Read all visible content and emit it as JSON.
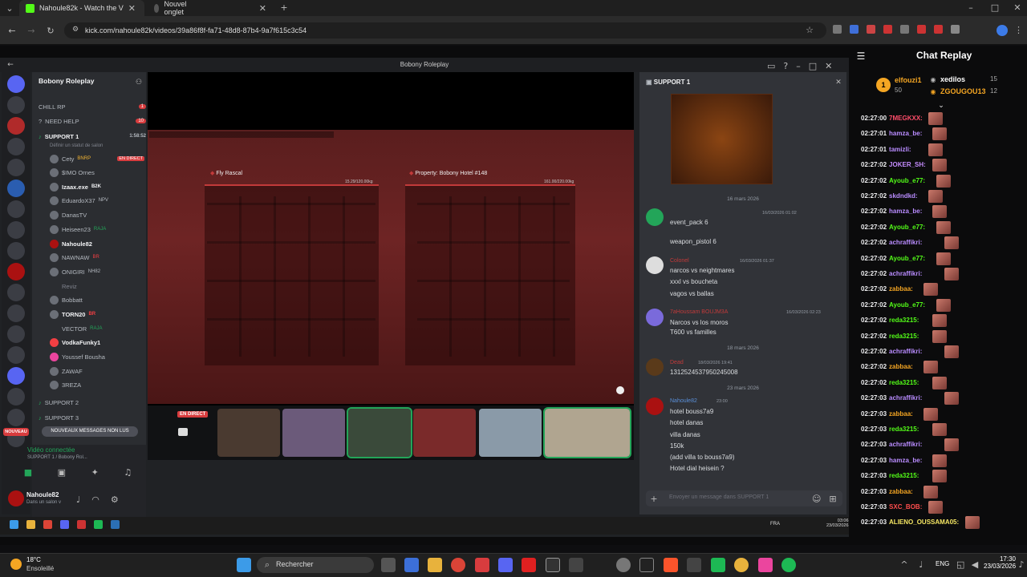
{
  "browser": {
    "tabs": [
      {
        "label": "Nahoule82k - Watch the V",
        "active": true
      },
      {
        "label": "Nouvel onglet",
        "active": false
      }
    ],
    "url": "kick.com/nahoule82k/videos/39a86f8f-fa71-48d8-87b4-9a7f615c3c54"
  },
  "discord": {
    "window_title": "Bobony Roleplay",
    "server_name": "Bobony Roleplay",
    "channels": [
      {
        "label": "CHILL RP",
        "badge": "1"
      },
      {
        "label": "NEED HELP",
        "badge": "10"
      },
      {
        "label": "SUPPORT 1",
        "badge": "1:58:52"
      }
    ],
    "status_hint": "Définir un statut de salon",
    "members": [
      {
        "name": "Cety",
        "tag": "BNRP",
        "live": "EN DIRECT"
      },
      {
        "name": "$IMO Ornes",
        "tag": ""
      },
      {
        "name": "Izaax.exe",
        "tag": "B2K"
      },
      {
        "name": "EduardoX37",
        "tag": "NPV"
      },
      {
        "name": "DanasTV",
        "tag": ""
      },
      {
        "name": "Heiseen23",
        "tag": "RAJA"
      },
      {
        "name": "Nahoule82",
        "tag": ""
      },
      {
        "name": "NAWNAW",
        "tag": "BR"
      },
      {
        "name": "ONIGIRI",
        "tag": "NH82"
      },
      {
        "name": "Reviz",
        "tag": ""
      },
      {
        "name": "Bobbatt",
        "tag": ""
      },
      {
        "name": "TORN20",
        "tag": "BR"
      },
      {
        "name": "VECTOR",
        "tag": "RAJA"
      },
      {
        "name": "VodkaFunky1",
        "tag": ""
      },
      {
        "name": "Youssef Bousha",
        "tag": ""
      },
      {
        "name": "ZAWAF",
        "tag": ""
      },
      {
        "name": "3REZA",
        "tag": ""
      }
    ],
    "other_channels": [
      "SUPPORT 2",
      "SUPPORT 3"
    ],
    "unread_button": "NOUVEAUX MESSAGES NON LUS",
    "voice_status": "Vidéo connectée",
    "voice_channel": "SUPPORT 1 / Bobony Rol...",
    "user_name": "Nahoule82",
    "user_status": "Dans un salon v",
    "new_badge": "NOUVEAU",
    "stream_live": "EN DIRECT",
    "game": {
      "left_panel": "Fly Rascal",
      "left_capacity": "15.29/120.00kg",
      "right_panel": "Property: Bobony Hotel #148",
      "right_capacity": "161.00/220.00kg"
    },
    "chat": {
      "channel": "SUPPORT 1",
      "messages": [
        {
          "type": "date",
          "text": "16 mars 2026"
        },
        {
          "type": "user",
          "name": "",
          "time": "16/03/2026 01:02",
          "lines": [
            "event_pack 6",
            "weapon_pistol 6"
          ]
        },
        {
          "type": "user",
          "name": "Colonel",
          "time": "16/03/2026 01:37",
          "lines": [
            "narcos vs neightmares",
            "xxxl vs boucheta",
            "vagos vs ballas"
          ]
        },
        {
          "type": "user",
          "name": "7aHoussam BOUJM3A",
          "time": "16/03/2026 02:23",
          "lines": [
            "Narcos vs los moros",
            "T600 vs familles"
          ]
        },
        {
          "type": "date",
          "text": "18 mars 2026"
        },
        {
          "type": "user",
          "name": "Dead",
          "time": "18/03/2026 19:41",
          "lines": [
            "1312524537950245008"
          ]
        },
        {
          "type": "date",
          "text": "23 mars 2026"
        },
        {
          "type": "user",
          "name": "Nahoule82",
          "time": "23:00",
          "lines": [
            "hotel bouss7a9",
            "hotel danas",
            "villa danas",
            "150k",
            "(add villa to bouss7a9)",
            "Hotel dial heisein ?"
          ]
        }
      ],
      "input_placeholder": "Envoyer un message dans"
    },
    "tray_lang": "FRA",
    "tray_time": "03:06",
    "tray_date": "23/03/2026"
  },
  "replay": {
    "title": "Chat Replay",
    "leaderboard": [
      {
        "rank": "1",
        "name": "elfouzi1",
        "count": "50"
      },
      {
        "name": "xedilos",
        "count": "15"
      },
      {
        "name": "ZGOUGOU13",
        "count": "12"
      }
    ],
    "messages": [
      {
        "time": "02:27:00",
        "user": "7MEGKXX:",
        "color": "#ff4d6a"
      },
      {
        "time": "02:27:01",
        "user": "hamza_be:",
        "color": "#b98cff"
      },
      {
        "time": "02:27:01",
        "user": "tamizli:",
        "color": "#b98cff"
      },
      {
        "time": "02:27:02",
        "user": "JOKER_SH:",
        "color": "#c58cff"
      },
      {
        "time": "02:27:02",
        "user": "Ayoub_e77:",
        "color": "#53fc18"
      },
      {
        "time": "02:27:02",
        "user": "skdndkd:",
        "color": "#b98cff"
      },
      {
        "time": "02:27:02",
        "user": "hamza_be:",
        "color": "#b98cff"
      },
      {
        "time": "02:27:02",
        "user": "Ayoub_e77:",
        "color": "#53fc18"
      },
      {
        "time": "02:27:02",
        "user": "achraffikri:",
        "color": "#b98cff"
      },
      {
        "time": "02:27:02",
        "user": "Ayoub_e77:",
        "color": "#53fc18"
      },
      {
        "time": "02:27:02",
        "user": "achraffikri:",
        "color": "#b98cff"
      },
      {
        "time": "02:27:02",
        "user": "zabbaa:",
        "color": "#f5a623"
      },
      {
        "time": "02:27:02",
        "user": "Ayoub_e77:",
        "color": "#53fc18"
      },
      {
        "time": "02:27:02",
        "user": "reda3215:",
        "color": "#53fc18"
      },
      {
        "time": "02:27:02",
        "user": "reda3215:",
        "color": "#53fc18"
      },
      {
        "time": "02:27:02",
        "user": "achraffikri:",
        "color": "#b98cff"
      },
      {
        "time": "02:27:02",
        "user": "zabbaa:",
        "color": "#f5a623"
      },
      {
        "time": "02:27:02",
        "user": "reda3215:",
        "color": "#53fc18"
      },
      {
        "time": "02:27:03",
        "user": "achraffikri:",
        "color": "#b98cff"
      },
      {
        "time": "02:27:03",
        "user": "zabbaa:",
        "color": "#f5a623"
      },
      {
        "time": "02:27:03",
        "user": "reda3215:",
        "color": "#53fc18"
      },
      {
        "time": "02:27:03",
        "user": "achraffikri:",
        "color": "#b98cff"
      },
      {
        "time": "02:27:03",
        "user": "hamza_be:",
        "color": "#b98cff"
      },
      {
        "time": "02:27:03",
        "user": "reda3215:",
        "color": "#53fc18"
      },
      {
        "time": "02:27:03",
        "user": "zabbaa:",
        "color": "#f5a623"
      },
      {
        "time": "02:27:03",
        "user": "SXC_BOB:",
        "color": "#ff4d4d"
      },
      {
        "time": "02:27:03",
        "user": "ALIENO_OUSSAMA05:",
        "color": "#f5e663"
      }
    ]
  },
  "taskbar": {
    "weather_temp": "18°C",
    "weather_text": "Ensoleillé",
    "search": "Rechercher",
    "lang": "ENG",
    "time": "17:30",
    "date": "23/03/2026"
  }
}
